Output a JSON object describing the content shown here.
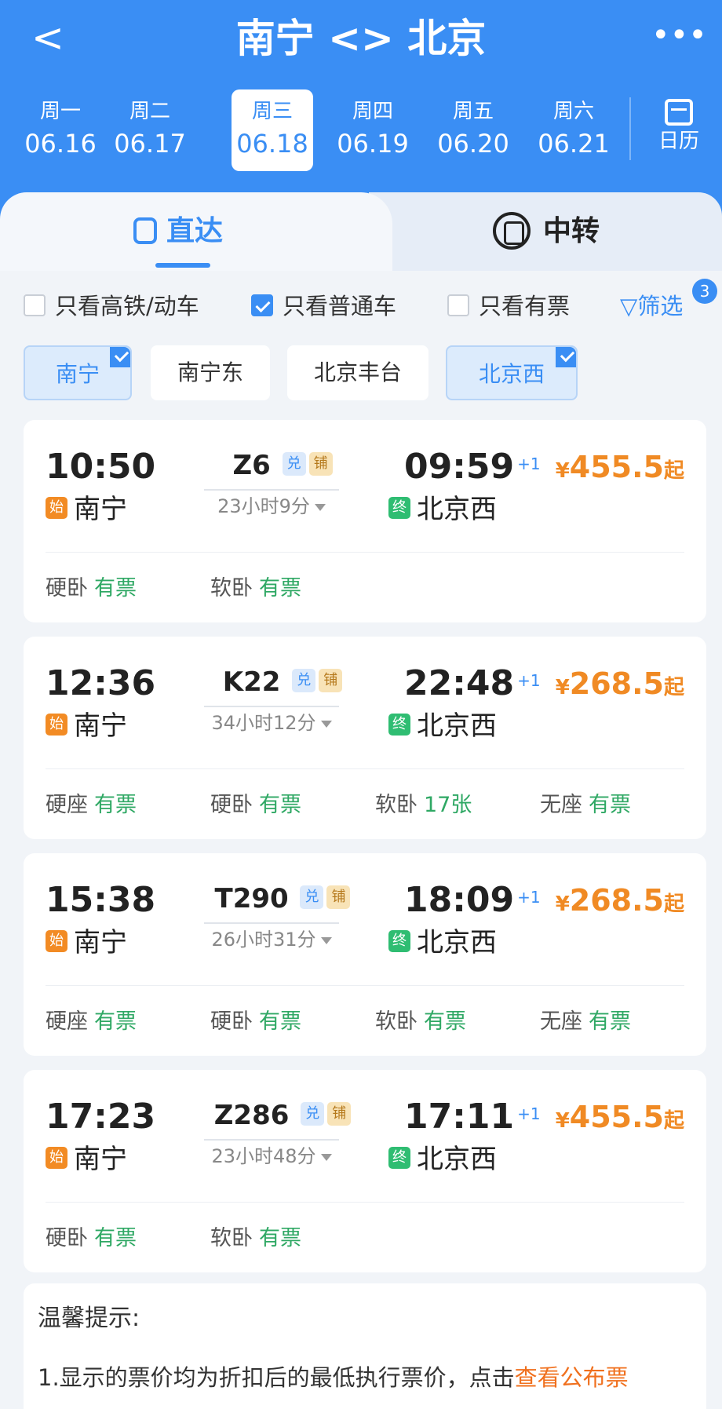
{
  "header": {
    "back_label": "<",
    "title": "南宁 <> 北京",
    "more_label": "•••"
  },
  "dates": [
    {
      "weekday": "周一",
      "date": "06.16",
      "active": false
    },
    {
      "weekday": "周二",
      "date": "06.17",
      "active": false
    },
    {
      "weekday": "周三",
      "date": "06.18",
      "active": true
    },
    {
      "weekday": "周四",
      "date": "06.19",
      "active": false
    },
    {
      "weekday": "周五",
      "date": "06.20",
      "active": false
    },
    {
      "weekday": "周六",
      "date": "06.21",
      "active": false
    }
  ],
  "calendar_label": "日历",
  "tabs": {
    "direct": "直达",
    "transfer": "中转"
  },
  "filters": {
    "high_speed": {
      "label": "只看高铁/动车",
      "checked": false
    },
    "normal": {
      "label": "只看普通车",
      "checked": true
    },
    "available": {
      "label": "只看有票",
      "checked": false
    },
    "screen_label": "筛选",
    "screen_badge": "3"
  },
  "stations": [
    {
      "name": "南宁",
      "selected": true
    },
    {
      "name": "南宁东",
      "selected": false
    },
    {
      "name": "北京丰台",
      "selected": false
    },
    {
      "name": "北京西",
      "selected": true
    }
  ],
  "station_tags": {
    "start": "始",
    "end": "终"
  },
  "ticket_tags": {
    "dui": "兑",
    "pu": "铺"
  },
  "trains": [
    {
      "dep_time": "10:50",
      "dep_station": "南宁",
      "number": "Z6",
      "duration": "23小时9分",
      "arr_time": "09:59",
      "arr_plus": "+1",
      "arr_station": "北京西",
      "price_yen": "¥",
      "price": "455.5",
      "price_suffix": "起",
      "seats": [
        {
          "type": "硬卧",
          "status": "有票"
        },
        {
          "type": "软卧",
          "status": "有票"
        }
      ]
    },
    {
      "dep_time": "12:36",
      "dep_station": "南宁",
      "number": "K22",
      "duration": "34小时12分",
      "arr_time": "22:48",
      "arr_plus": "+1",
      "arr_station": "北京西",
      "price_yen": "¥",
      "price": "268.5",
      "price_suffix": "起",
      "seats": [
        {
          "type": "硬座",
          "status": "有票"
        },
        {
          "type": "硬卧",
          "status": "有票"
        },
        {
          "type": "软卧",
          "status": "17张"
        },
        {
          "type": "无座",
          "status": "有票"
        }
      ]
    },
    {
      "dep_time": "15:38",
      "dep_station": "南宁",
      "number": "T290",
      "duration": "26小时31分",
      "arr_time": "18:09",
      "arr_plus": "+1",
      "arr_station": "北京西",
      "price_yen": "¥",
      "price": "268.5",
      "price_suffix": "起",
      "seats": [
        {
          "type": "硬座",
          "status": "有票"
        },
        {
          "type": "硬卧",
          "status": "有票"
        },
        {
          "type": "软卧",
          "status": "有票"
        },
        {
          "type": "无座",
          "status": "有票"
        }
      ]
    },
    {
      "dep_time": "17:23",
      "dep_station": "南宁",
      "number": "Z286",
      "duration": "23小时48分",
      "arr_time": "17:11",
      "arr_plus": "+1",
      "arr_station": "北京西",
      "price_yen": "¥",
      "price": "455.5",
      "price_suffix": "起",
      "seats": [
        {
          "type": "硬卧",
          "status": "有票"
        },
        {
          "type": "软卧",
          "status": "有票"
        }
      ]
    }
  ],
  "tips": {
    "title": "温馨提示:",
    "line1_text": "1.显示的票价均为折扣后的最低执行票价，点击",
    "line1_link": "查看公布票"
  },
  "colors": {
    "primary": "#3a8ef4",
    "price": "#f08a24",
    "available": "#2fa864",
    "start_tag": "#f28b24",
    "end_tag": "#2fbd72"
  }
}
